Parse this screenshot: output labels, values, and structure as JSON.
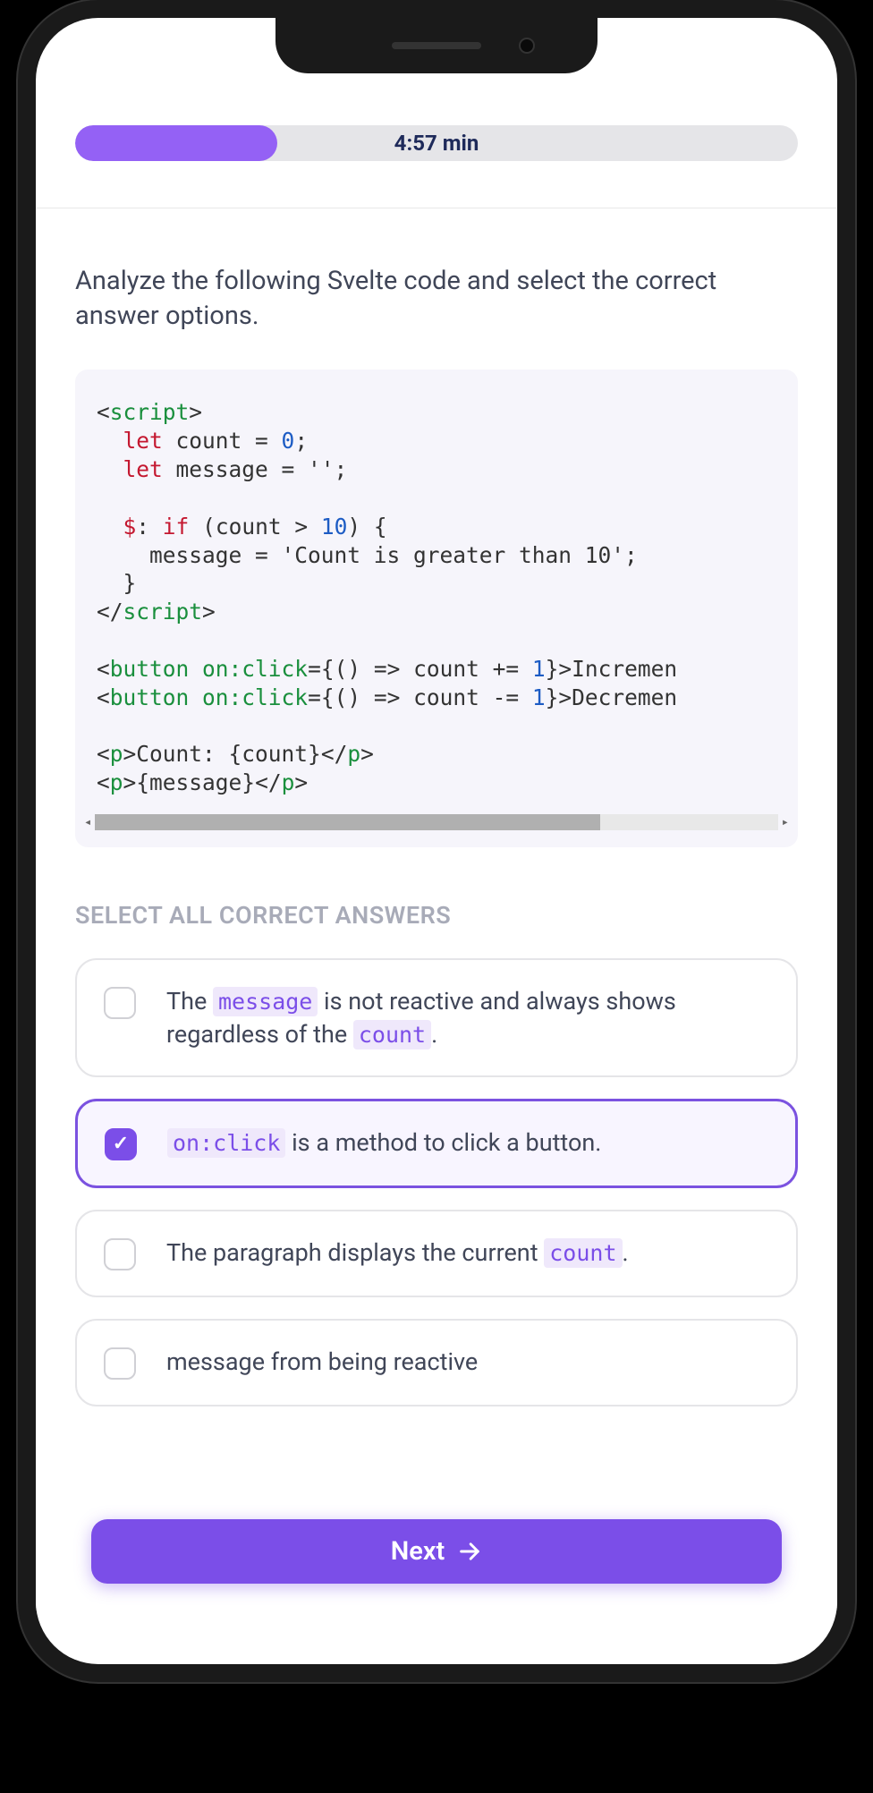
{
  "progress": {
    "percent": 28,
    "timer_text": "4:57 min"
  },
  "question": "Analyze the following Svelte code and select the correct answer options.",
  "code": {
    "lines": [
      {
        "html": "<span class='tok-punc'>&lt;</span><span class='tok-tag'>script</span><span class='tok-punc'>&gt;</span>"
      },
      {
        "html": "  <span class='tok-keyword'>let</span> count = <span class='tok-number'>0</span>;"
      },
      {
        "html": "  <span class='tok-keyword'>let</span> message = '';"
      },
      {
        "html": ""
      },
      {
        "html": "  <span class='tok-label'>$</span>: <span class='tok-keyword'>if</span> (count &gt; <span class='tok-number'>10</span>) {"
      },
      {
        "html": "    message = 'Count is greater than 10';"
      },
      {
        "html": "  }"
      },
      {
        "html": "<span class='tok-punc'>&lt;/</span><span class='tok-tag'>script</span><span class='tok-punc'>&gt;</span>"
      },
      {
        "html": ""
      },
      {
        "html": "<span class='tok-punc'>&lt;</span><span class='tok-tag'>button</span> <span class='tok-attr'>on:click</span>={() =&gt; count += <span class='tok-number'>1</span>}&gt;Incremen"
      },
      {
        "html": "<span class='tok-punc'>&lt;</span><span class='tok-tag'>button</span> <span class='tok-attr'>on:click</span>={() =&gt; count -= <span class='tok-number'>1</span>}&gt;Decremen"
      },
      {
        "html": ""
      },
      {
        "html": "<span class='tok-punc'>&lt;</span><span class='tok-tag'>p</span><span class='tok-punc'>&gt;</span>Count: {count}<span class='tok-punc'>&lt;/</span><span class='tok-tag'>p</span><span class='tok-punc'>&gt;</span>"
      },
      {
        "html": "<span class='tok-punc'>&lt;</span><span class='tok-tag'>p</span><span class='tok-punc'>&gt;</span>{message}<span class='tok-punc'>&lt;/</span><span class='tok-tag'>p</span><span class='tok-punc'>&gt;</span>"
      }
    ]
  },
  "section_title": "SELECT ALL CORRECT ANSWERS",
  "answers": [
    {
      "selected": false,
      "parts": [
        {
          "t": "text",
          "v": "The "
        },
        {
          "t": "code",
          "v": "message"
        },
        {
          "t": "text",
          "v": " is not reactive and always shows regardless of the "
        },
        {
          "t": "code",
          "v": "count"
        },
        {
          "t": "text",
          "v": "."
        }
      ]
    },
    {
      "selected": true,
      "parts": [
        {
          "t": "code",
          "v": "on:click"
        },
        {
          "t": "text",
          "v": " is a method to click a button."
        }
      ]
    },
    {
      "selected": false,
      "parts": [
        {
          "t": "text",
          "v": "The paragraph displays the current "
        },
        {
          "t": "code",
          "v": "count"
        },
        {
          "t": "text",
          "v": "."
        }
      ]
    },
    {
      "selected": false,
      "parts": [
        {
          "t": "text",
          "v": "message from being reactive"
        }
      ]
    }
  ],
  "next_label": "Next"
}
